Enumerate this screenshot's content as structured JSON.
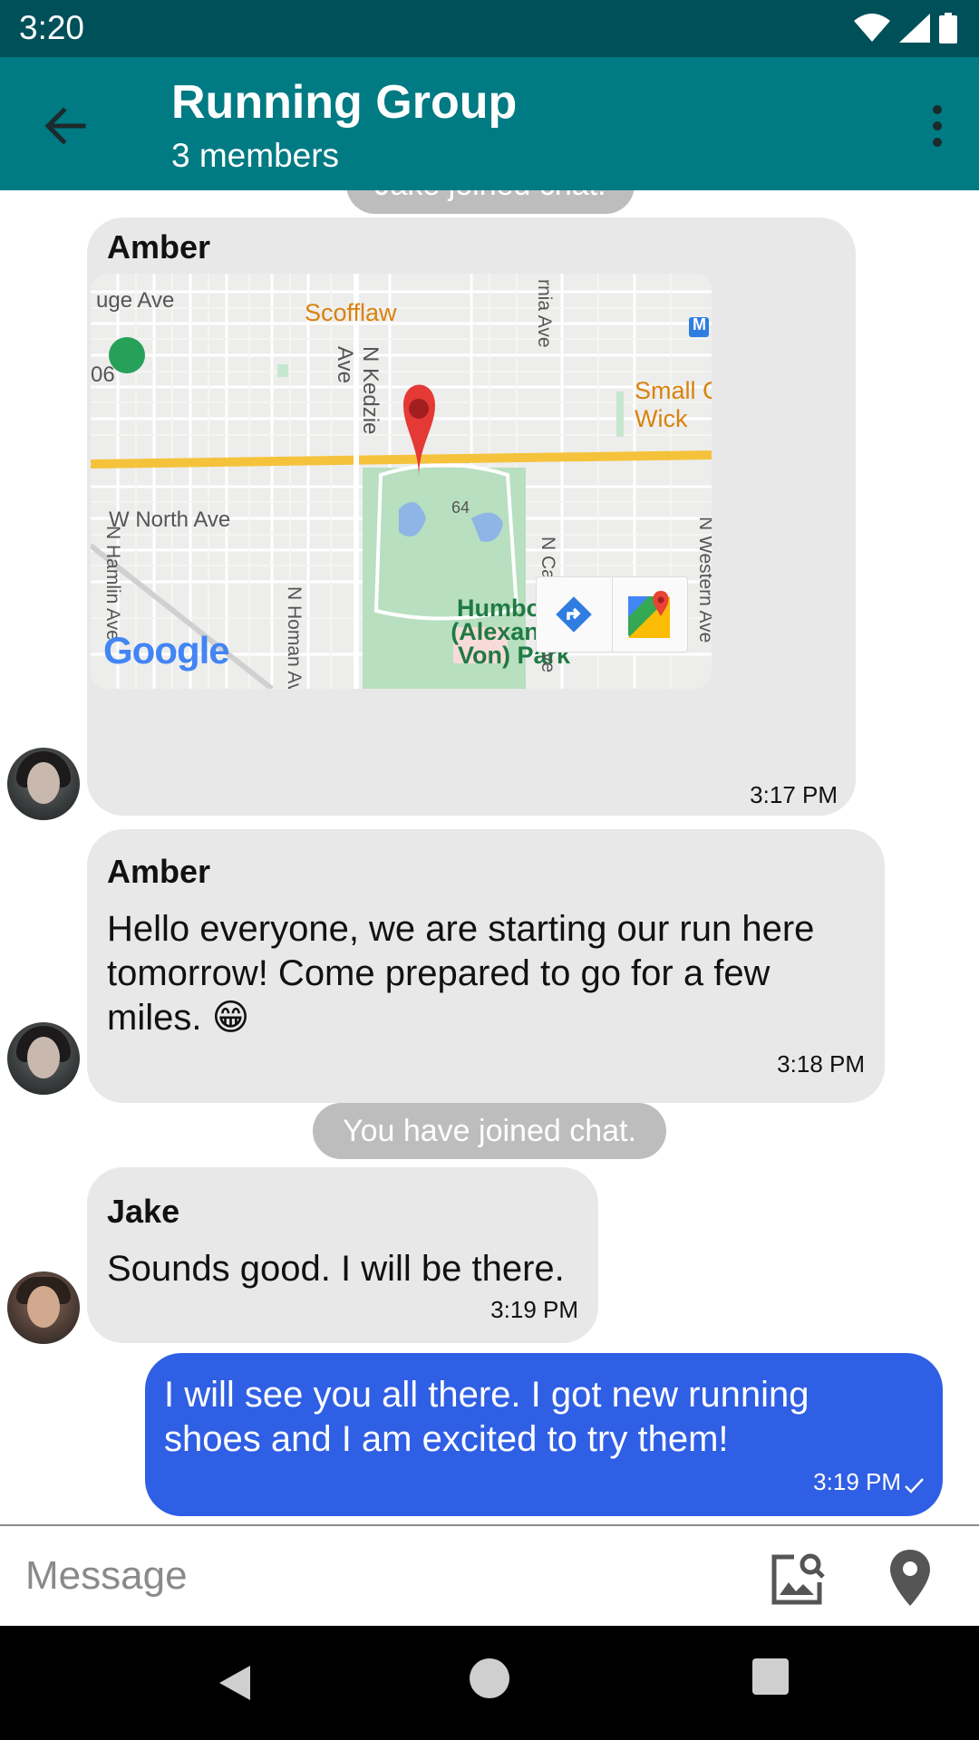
{
  "status_bar": {
    "time": "3:20"
  },
  "header": {
    "title": "Running Group",
    "subtitle": "3 members"
  },
  "chat": {
    "system_top": "Jake joined chat.",
    "location_message": {
      "sender": "Amber",
      "time": "3:17 PM",
      "map": {
        "labels": {
          "scofflaw": "Scofflaw",
          "w_north_ave": "W North Ave",
          "humboldt_park": "Humboldt (Alexander Von) Park",
          "n_kedzie_ave": "N Kedzie Ave",
          "n_hamlin_ave": "N Hamlin Ave",
          "n_homan_ave": "N Homan Ave",
          "n_california_ave": "N California Ave",
          "n_western_ave": "N Western Ave",
          "rnia_ave": "rnia Ave",
          "uge_ave": "uge Ave",
          "small_wick": "Small C Wick",
          "route_06": "06",
          "route_64": "64",
          "metro": "M"
        },
        "logo": "Google"
      }
    },
    "text_message_1": {
      "sender": "Amber",
      "text": "Hello everyone, we are starting our run here tomorrow! Come prepared to go for a few miles. 😁",
      "time": "3:18 PM"
    },
    "system_joined": "You have joined chat.",
    "text_message_2": {
      "sender": "Jake",
      "text": "Sounds good. I will be there.",
      "time": "3:19 PM"
    },
    "outgoing_message": {
      "text": "I will see you all there. I got new running shoes and I am excited to try them!",
      "time": "3:19 PM"
    }
  },
  "composer": {
    "placeholder": "Message"
  },
  "colors": {
    "status_bar": "#00505a",
    "app_bar": "#007a83",
    "incoming_bubble": "#e8e8e8",
    "outgoing_bubble": "#2f5fe4",
    "system_pill": "#bdbdbd"
  },
  "icons": {
    "back": "arrow-left-icon",
    "overflow": "more-vert-icon",
    "image": "image-search-icon",
    "location": "location-pin-icon"
  }
}
